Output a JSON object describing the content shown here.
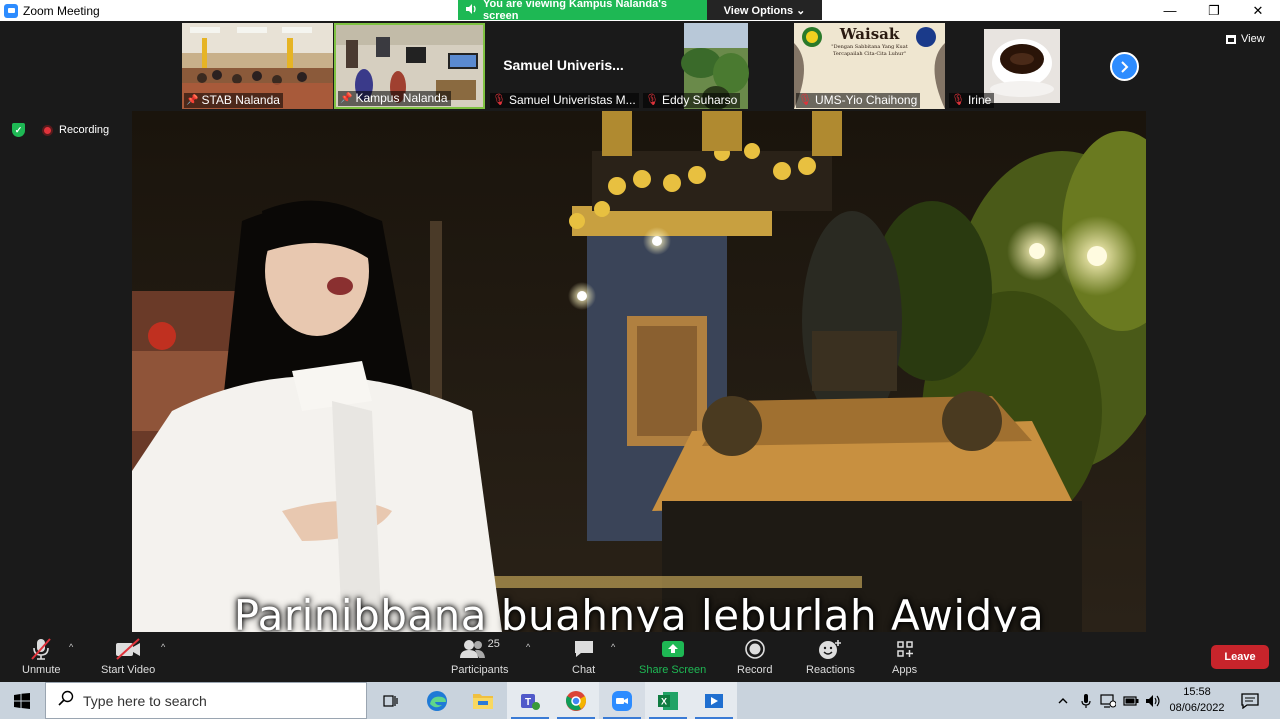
{
  "window": {
    "title": "Zoom Meeting",
    "minimize": "—",
    "restore": "❐",
    "close": "✕"
  },
  "share_banner": {
    "message": "You are viewing Kampus Nalanda's screen",
    "view_options": "View Options ⌄"
  },
  "gallery": {
    "participants": [
      {
        "name": "STAB Nalanda",
        "state": "pinned"
      },
      {
        "name": "Kampus Nalanda",
        "state": "pinned"
      },
      {
        "name": "Samuel Univeristas M...",
        "display": "Samuel  Univeris...",
        "state": "muted"
      },
      {
        "name": "Eddy Suharso",
        "state": "muted"
      },
      {
        "name": "UMS-Yio Chaihong",
        "state": "muted"
      },
      {
        "name": "Irine",
        "state": "muted"
      }
    ],
    "view_label": "View",
    "waisak_title": "Waisak",
    "waisak_sub1": "\"Dengan Sabbitana Yang Kuat",
    "waisak_sub2": "Tercapailah Cita-Cita Luhur\""
  },
  "status": {
    "recording": "Recording"
  },
  "main_video": {
    "caption": "Parinibbana buahnya leburlah Awidya"
  },
  "toolbar": {
    "unmute": "Unmute",
    "start_video": "Start Video",
    "participants": "Participants",
    "participant_count": "25",
    "chat": "Chat",
    "share_screen": "Share Screen",
    "record": "Record",
    "reactions": "Reactions",
    "apps": "Apps",
    "leave": "Leave",
    "caret": "^"
  },
  "taskbar": {
    "search_placeholder": "Type here to search",
    "time": "15:58",
    "date": "08/06/2022"
  },
  "colors": {
    "zoom_blue": "#2d8cff",
    "share_green": "#1eb854",
    "leave_red": "#c7242b",
    "mute_red": "#e0333b"
  }
}
